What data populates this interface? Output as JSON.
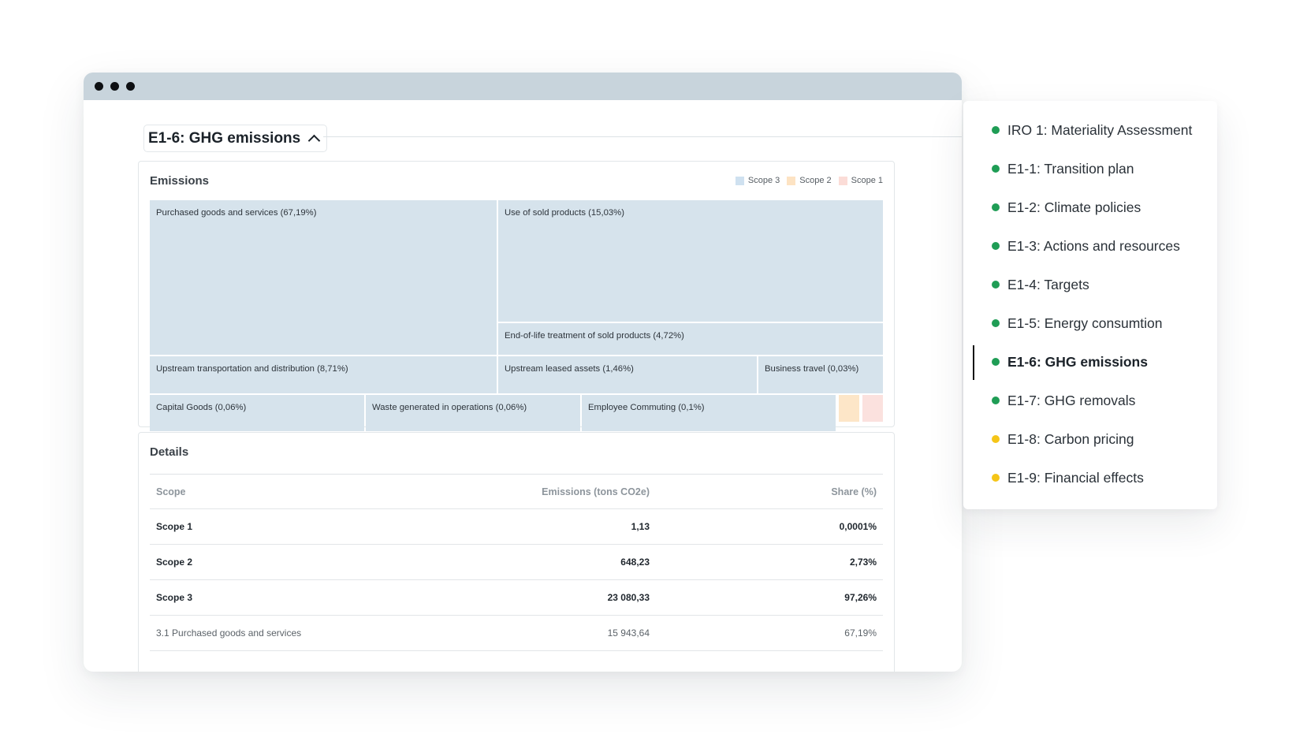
{
  "section": {
    "title": "E1-6: GHG emissions"
  },
  "emissions": {
    "title": "Emissions",
    "legend": [
      {
        "label": "Scope 3",
        "color": "#cfe1f0"
      },
      {
        "label": "Scope 2",
        "color": "#fde3c3"
      },
      {
        "label": "Scope 1",
        "color": "#fbdcd7"
      }
    ],
    "treemap": [
      {
        "label": "Purchased goods and services (67,19%)",
        "scope": "Scope 3"
      },
      {
        "label": "Use of sold products (15,03%)",
        "scope": "Scope 3"
      },
      {
        "label": "End-of-life treatment of sold products (4,72%)",
        "scope": "Scope 3"
      },
      {
        "label": "Upstream transportation and distribution (8,71%)",
        "scope": "Scope 3"
      },
      {
        "label": "Upstream leased assets (1,46%)",
        "scope": "Scope 3"
      },
      {
        "label": "Business travel (0,03%)",
        "scope": "Scope 3"
      },
      {
        "label": "Capital Goods (0,06%)",
        "scope": "Scope 3"
      },
      {
        "label": "Waste generated in operations (0,06%)",
        "scope": "Scope 3"
      },
      {
        "label": "Employee Commuting (0,1%)",
        "scope": "Scope 3"
      },
      {
        "label": "",
        "scope": "Scope 2"
      },
      {
        "label": "",
        "scope": "Scope 1"
      }
    ]
  },
  "details": {
    "title": "Details",
    "columns": [
      "Scope",
      "Emissions (tons CO2e)",
      "Share (%)"
    ],
    "rows": [
      [
        "Scope 1",
        "1,13",
        "0,0001%"
      ],
      [
        "Scope 2",
        "648,23",
        "2,73%"
      ],
      [
        "Scope 3",
        "23 080,33",
        "97,26%"
      ],
      [
        "3.1 Purchased goods and services",
        "15 943,64",
        "67,19%"
      ]
    ]
  },
  "nav": {
    "active_index": 6,
    "items": [
      {
        "label": "IRO 1: Materiality Assessment",
        "status": "complete"
      },
      {
        "label": "E1-1: Transition plan",
        "status": "complete"
      },
      {
        "label": "E1-2: Climate policies",
        "status": "complete"
      },
      {
        "label": "E1-3: Actions and resources",
        "status": "complete"
      },
      {
        "label": "E1-4: Targets",
        "status": "complete"
      },
      {
        "label": "E1-5: Energy consumtion",
        "status": "complete"
      },
      {
        "label": "E1-6: GHG emissions",
        "status": "complete"
      },
      {
        "label": "E1-7: GHG removals",
        "status": "complete"
      },
      {
        "label": "E1-8: Carbon pricing",
        "status": "pending"
      },
      {
        "label": "E1-9: Financial effects",
        "status": "pending"
      }
    ],
    "status_colors": {
      "complete": "#1f9d55",
      "pending": "#f5c518"
    }
  }
}
